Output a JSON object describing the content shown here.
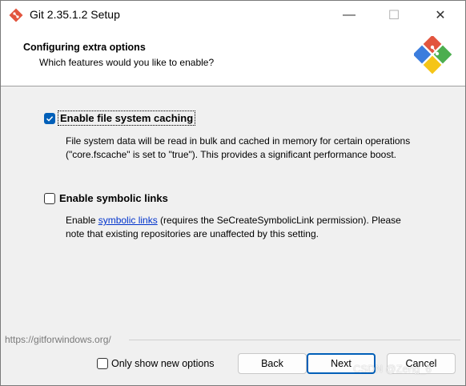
{
  "window": {
    "title": "Git 2.35.1.2 Setup",
    "controls": {
      "minimize": "—",
      "maximize": "☐",
      "close": "✕"
    }
  },
  "header": {
    "title": "Configuring extra options",
    "subtitle": "Which features would you like to enable?"
  },
  "options": [
    {
      "label": "Enable file system caching",
      "checked": true,
      "description": "File system data will be read in bulk and cached in memory for certain operations (\"core.fscache\" is set to \"true\"). This provides a significant performance boost."
    },
    {
      "label": "Enable symbolic links",
      "checked": false,
      "description_pre": "Enable ",
      "description_link": "symbolic links",
      "description_post": " (requires the SeCreateSymbolicLink permission). Please note that existing repositories are unaffected by this setting."
    }
  ],
  "footer": {
    "url": "https://gitforwindows.org/",
    "only_new_label": "Only show new options",
    "back": "Back",
    "next": "Next",
    "cancel": "Cancel",
    "watermark": "CSDN @Zeng_6"
  },
  "colors": {
    "accent": "#005fb8",
    "link": "#0033cc",
    "git_red": "#e2553e"
  }
}
